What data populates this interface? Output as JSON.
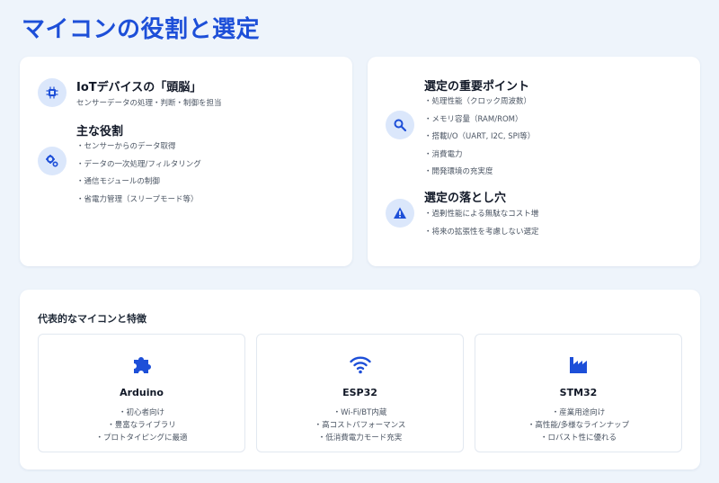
{
  "page": {
    "title": "マイコンの役割と選定"
  },
  "left_card": {
    "brain": {
      "title": "IoTデバイスの「頭脳」",
      "subtitle": "センサーデータの処理・判断・制御を担当",
      "icon": "chip-icon"
    },
    "roles": {
      "title": "主な役割",
      "icon": "gears-icon",
      "items": [
        "・センサーからのデータ取得",
        "・データの一次処理/フィルタリング",
        "・通信モジュールの制御",
        "・省電力管理（スリープモード等）"
      ]
    }
  },
  "right_card": {
    "points": {
      "title": "選定の重要ポイント",
      "icon": "search-icon",
      "items": [
        "・処理性能（クロック周波数）",
        "・メモリ容量（RAM/ROM）",
        "・搭載I/O（UART, I2C, SPI等）",
        "・消費電力",
        "・開発環境の充実度"
      ]
    },
    "pitfalls": {
      "title": "選定の落とし穴",
      "icon": "warning-icon",
      "items": [
        "・過剰性能による無駄なコスト増",
        "・将来の拡張性を考慮しない選定"
      ]
    }
  },
  "bottom": {
    "title": "代表的なマイコンと特徴",
    "mcus": [
      {
        "name": "Arduino",
        "icon": "puzzle-icon",
        "features": [
          "・初心者向け",
          "・豊富なライブラリ",
          "・プロトタイピングに最適"
        ]
      },
      {
        "name": "ESP32",
        "icon": "wifi-icon",
        "features": [
          "・Wi-Fi/BT内蔵",
          "・高コストパフォーマンス",
          "・低消費電力モード充実"
        ]
      },
      {
        "name": "STM32",
        "icon": "factory-icon",
        "features": [
          "・産業用途向け",
          "・高性能/多様なラインナップ",
          "・ロバスト性に優れる"
        ]
      }
    ]
  },
  "colors": {
    "accent": "#1d4fd8",
    "icon_bg": "#dbe7fb",
    "background": "#eef4fb"
  }
}
